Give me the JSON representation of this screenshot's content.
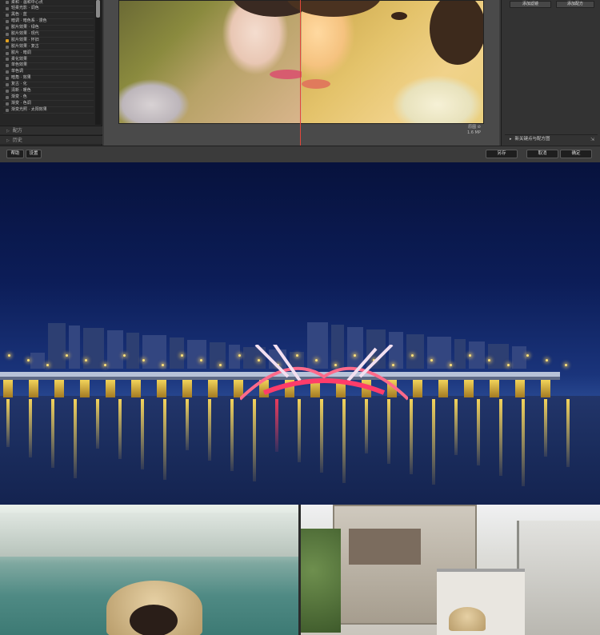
{
  "presets": {
    "items": [
      "柔和 · 温和中心点",
      "轻柔光影 · 调色",
      "黑色 · 蓝",
      "暗调 · 暗色系 · 漫色",
      "胶片效果 · 绿色",
      "胶片效果 · 现代",
      "胶片效果 · 怀旧",
      "胶片效果 · 复古",
      "胶片 · 暗调",
      "柔化效果",
      "单色效果",
      "单色调",
      "暗角 · 效果",
      "复古 · 化",
      "清新 · 暖色",
      "渐变 · 色",
      "渐变 · 色调",
      "渐变光照 · 太阳效果"
    ],
    "active_index": 6
  },
  "panel_rows": {
    "row1": "配方",
    "row2": "历史"
  },
  "right_panel": {
    "btn_left": "添加滤镜",
    "btn_right": "添加配方",
    "footer": "新关键点与配方图"
  },
  "preview": {
    "caption_line1": "原图 ⊘",
    "caption_line2": "1.6 MP"
  },
  "bottom_bar": {
    "btn_help": "帮助",
    "btn_settings": "设置",
    "btn_save": "另存",
    "btn_cancel": "取消",
    "btn_ok": "确定"
  },
  "colors": {
    "split_line": "#e2473b",
    "active_bullet": "#e0a020",
    "night_sky_top": "#07123d"
  }
}
